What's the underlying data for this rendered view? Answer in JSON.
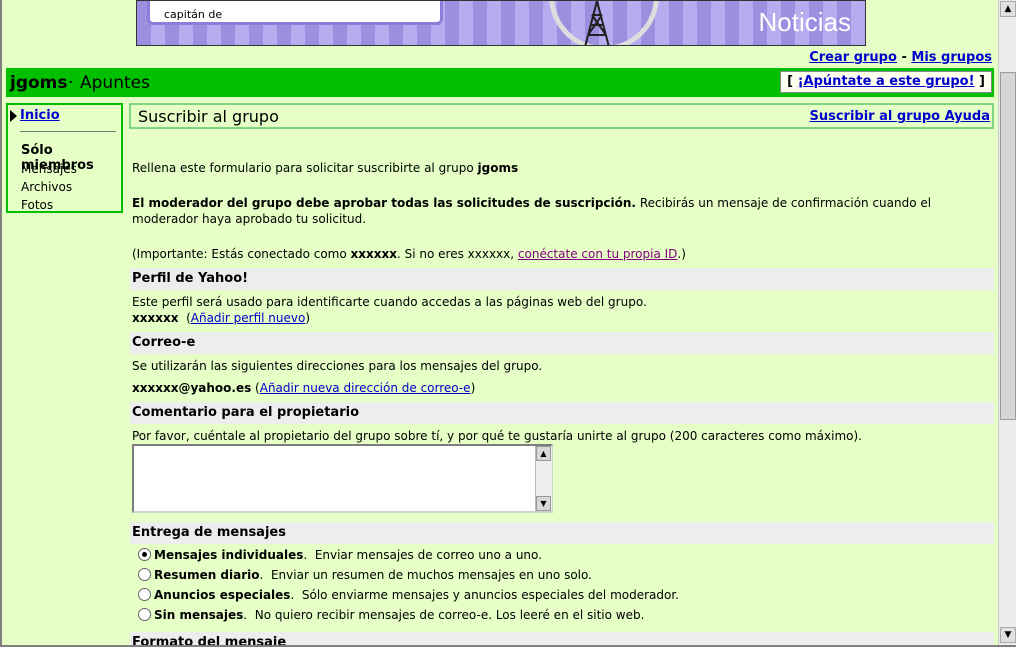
{
  "banner": {
    "box_text": "capitán de",
    "title": "Noticias"
  },
  "top_links": {
    "create_group": "Crear grupo",
    "separator": "-",
    "my_groups": "Mis grupos"
  },
  "header": {
    "group_name": "jgoms",
    "separator": "·",
    "subtitle": "Apuntes",
    "join_bracket_open": "[",
    "join_label": "¡Apúntate a este grupo!",
    "join_bracket_close": "]"
  },
  "sidebar": {
    "home": "Inicio",
    "members_only": "Sólo miembros",
    "items": [
      "Mensajes",
      "Archivos",
      "Fotos"
    ]
  },
  "title_bar": {
    "title": "Suscribir al grupo",
    "help": "Suscribir al grupo Ayuda"
  },
  "intro": {
    "text": "Rellena este formulario para solicitar suscribirte al grupo",
    "group": "jgoms"
  },
  "moderator": {
    "bold": "El moderador del grupo debe aprobar todas las solicitudes de suscripción.",
    "rest": "Recibirás un mensaje de confirmación cuando el moderador haya aprobado tu solicitud."
  },
  "important": {
    "prefix": "(Importante: Estás conectado como",
    "user": "xxxxxx",
    "middle": ". Si no eres xxxxxx,",
    "link": "conéctate con tu propia ID",
    "suffix": ".)"
  },
  "profile": {
    "heading": "Perfil de Yahoo!",
    "desc": "Este perfil será usado para identificarte cuando accedas a las páginas web del grupo.",
    "name": "xxxxxx",
    "add_link": "Añadir perfil nuevo"
  },
  "email": {
    "heading": "Correo-e",
    "desc": "Se utilizarán las siguientes direcciones para los mensajes del grupo.",
    "address": "xxxxxx@yahoo.es",
    "add_link": "Añadir nueva dirección de correo-e"
  },
  "comment": {
    "heading": "Comentario para el propietario",
    "desc": "Por favor, cuéntale al propietario del grupo sobre tí, y por qué te gustaría unirte al grupo (200 caracteres como máximo).",
    "value": ""
  },
  "delivery": {
    "heading": "Entrega de mensajes",
    "options": [
      {
        "label": "Mensajes individuales",
        "desc": "Enviar mensajes de correo uno a uno.",
        "selected": true
      },
      {
        "label": "Resumen diario",
        "desc": "Enviar un resumen de muchos mensajes en uno solo.",
        "selected": false
      },
      {
        "label": "Anuncios especiales",
        "desc": "Sólo enviarme mensajes y anuncios especiales del moderador.",
        "selected": false
      },
      {
        "label": "Sin mensajes",
        "desc": "No quiero recibir mensajes de correo-e. Los leeré en el sitio web.",
        "selected": false
      }
    ]
  },
  "format": {
    "heading": "Formato del mensaje"
  }
}
